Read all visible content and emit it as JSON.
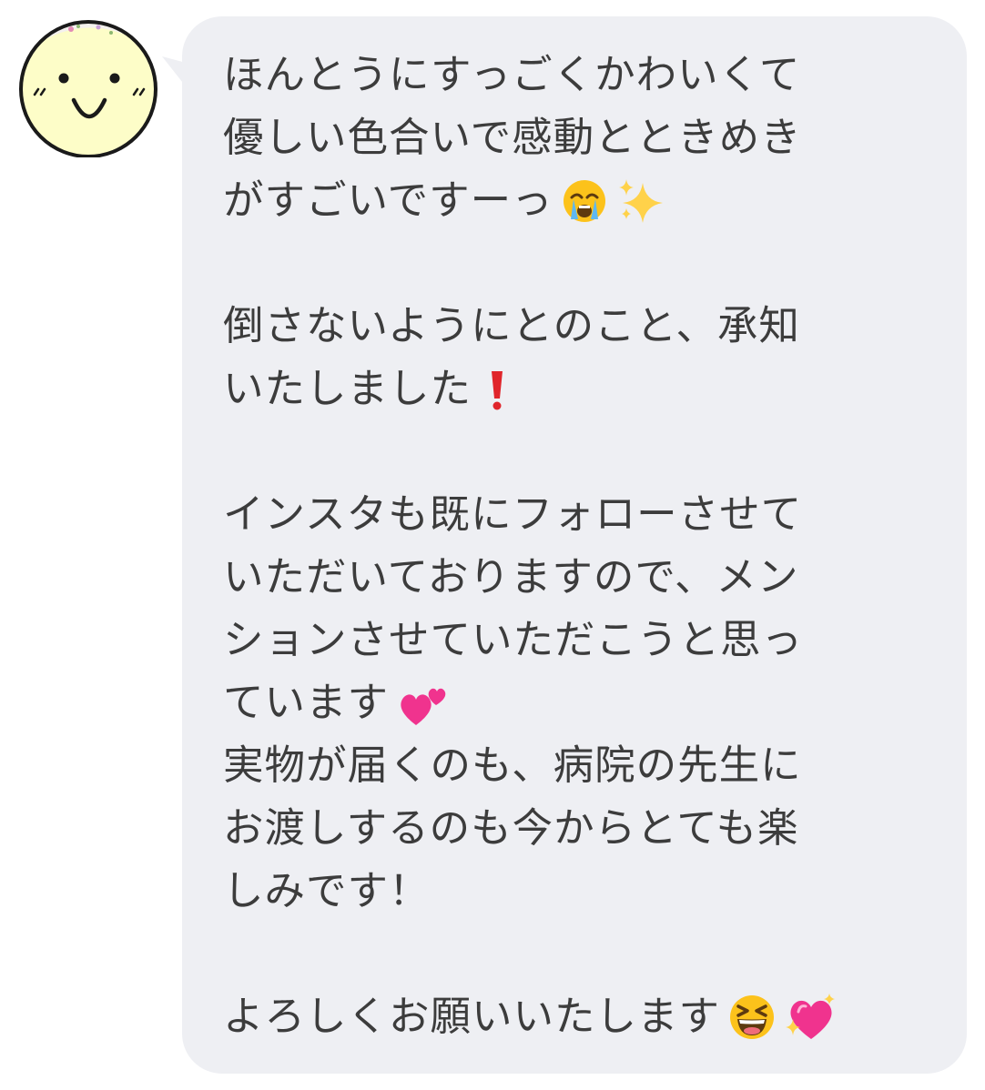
{
  "message": {
    "lines": [
      "ほんとうにすっごくかわいくて",
      "優しい色合いで感動とときめき",
      "がすごいですーっ",
      "",
      "倒さないようにとのこと、承知",
      "いたしました",
      "",
      "インスタも既にフォローさせて",
      "いただいておりますので、メン",
      "ションさせていただこうと思っ",
      "ています",
      "実物が届くのも、病院の先生に",
      "お渡しするのも今からとても楽",
      "しみです！",
      "",
      "よろしくお願いいたします"
    ],
    "icons": {
      "line3": [
        "loudly-crying-face-emoji-icon",
        "sparkles-emoji-icon"
      ],
      "line6": [
        "red-exclamation-emoji-icon"
      ],
      "line11": [
        "two-hearts-emoji-icon"
      ],
      "line16": [
        "grinning-squinting-face-emoji-icon",
        "sparkling-heart-emoji-icon"
      ]
    }
  },
  "colors": {
    "bubble_bg": "#eeeff3",
    "text": "#3c3c3c",
    "avatar_face": "#fdfdc8"
  }
}
